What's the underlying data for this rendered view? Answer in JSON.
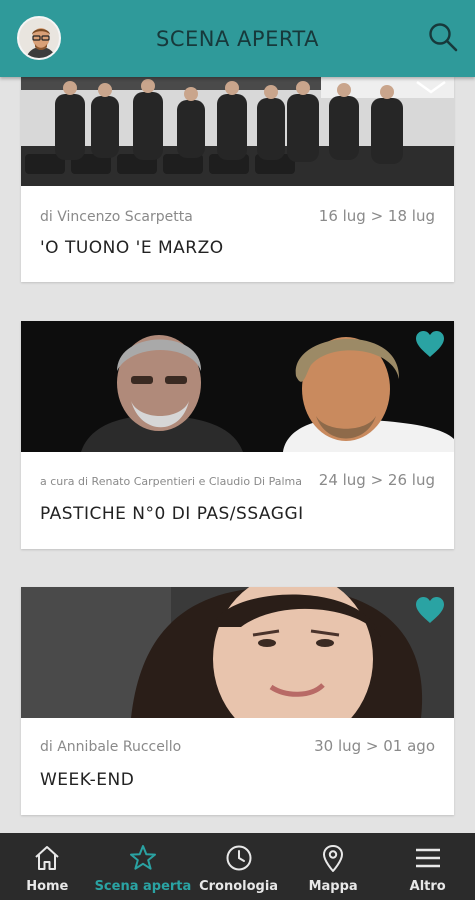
{
  "header": {
    "title": "SCENA APERTA"
  },
  "colors": {
    "brand": "#2f9a9a",
    "accent": "#2aa3a3",
    "nav_bg": "#2b2b2b"
  },
  "events": [
    {
      "author": "di Vincenzo Scarpetta",
      "dates": "16 lug > 18 lug",
      "title": "'O TUONO 'E MARZO",
      "favorite": false
    },
    {
      "author": "a cura di Renato Carpentieri e Claudio Di Palma",
      "dates": "24 lug > 26 lug",
      "title": "PASTICHE N°0 DI PAS/SSAGGI",
      "favorite": true
    },
    {
      "author": "di Annibale Ruccello",
      "dates": "30 lug > 01 ago",
      "title": "WEEK-END",
      "favorite": true
    }
  ],
  "nav": {
    "items": [
      {
        "label": "Home",
        "icon": "home-icon",
        "active": false
      },
      {
        "label": "Scena aperta",
        "icon": "star-icon",
        "active": true
      },
      {
        "label": "Cronologia",
        "icon": "clock-icon",
        "active": false
      },
      {
        "label": "Mappa",
        "icon": "map-pin-icon",
        "active": false
      },
      {
        "label": "Altro",
        "icon": "menu-icon",
        "active": false
      }
    ]
  }
}
